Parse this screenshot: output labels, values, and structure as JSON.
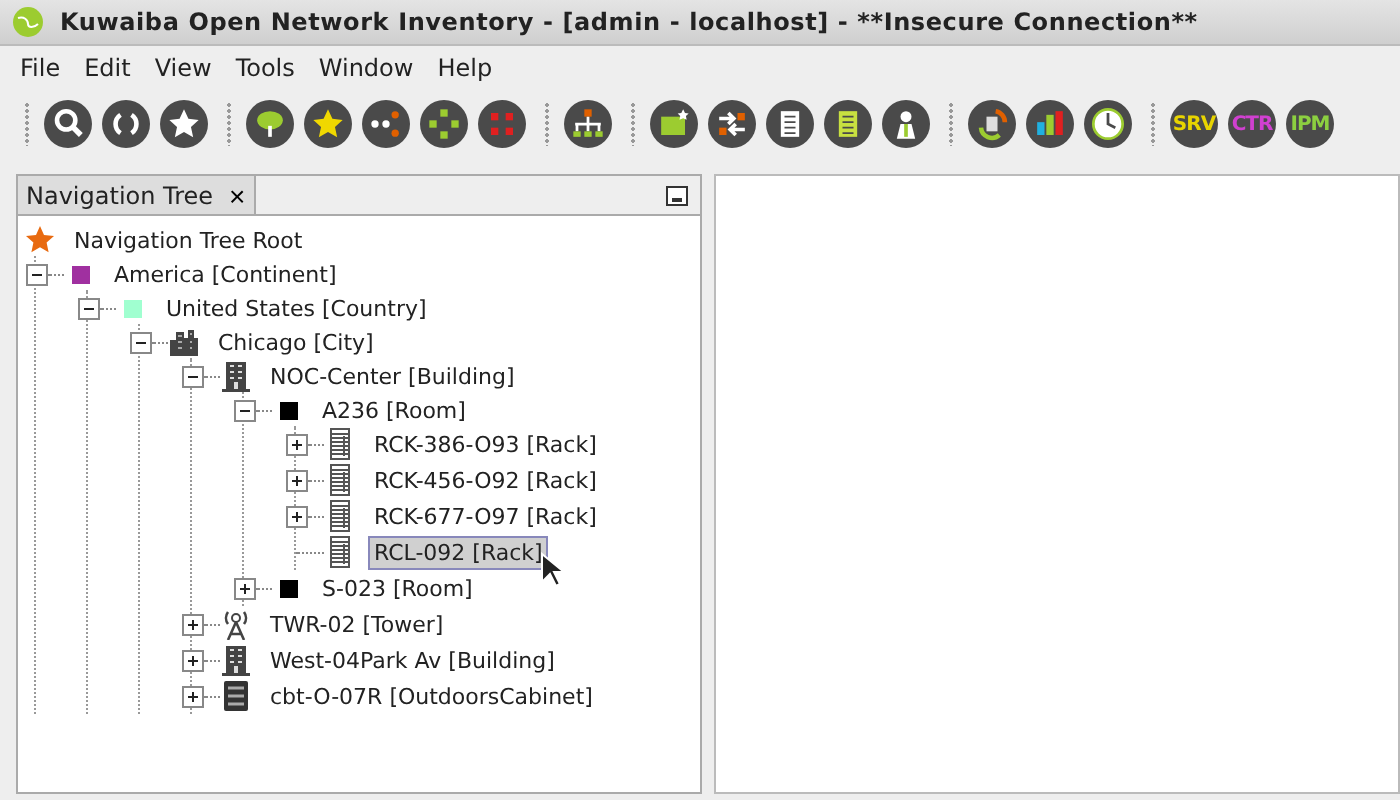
{
  "window": {
    "title": "Kuwaiba Open Network Inventory - [admin - localhost] - **Insecure Connection**"
  },
  "menu": [
    "File",
    "Edit",
    "View",
    "Tools",
    "Window",
    "Help"
  ],
  "toolbar": [
    [
      {
        "kind": "search"
      },
      {
        "kind": "refresh"
      },
      {
        "kind": "star"
      }
    ],
    [
      {
        "kind": "tree"
      },
      {
        "kind": "star-yellow"
      },
      {
        "kind": "nodes"
      },
      {
        "kind": "diamond"
      },
      {
        "kind": "grid"
      }
    ],
    [
      {
        "kind": "hierarchy"
      }
    ],
    [
      {
        "kind": "folder"
      },
      {
        "kind": "swap"
      },
      {
        "kind": "document"
      },
      {
        "kind": "document-green"
      },
      {
        "kind": "person"
      }
    ],
    [
      {
        "kind": "sync"
      },
      {
        "kind": "chart"
      },
      {
        "kind": "clock"
      }
    ],
    [
      {
        "kind": "text",
        "label": "SRV",
        "color": "#e8d400"
      },
      {
        "kind": "text",
        "label": "CTR",
        "color": "#d040d0"
      },
      {
        "kind": "text",
        "label": "IPM",
        "color": "#8cd040"
      }
    ]
  ],
  "panel": {
    "tab": "Navigation Tree",
    "close": "×"
  },
  "tree": {
    "label": "Navigation Tree Root",
    "kind": "star",
    "selected": false,
    "children": [
      {
        "label": "America [Continent]",
        "kind": "square",
        "color": "#a030a0",
        "expanded": true,
        "selected": false,
        "children": [
          {
            "label": "United States [Country]",
            "kind": "square",
            "color": "#a0ffd0",
            "expanded": true,
            "selected": false,
            "children": [
              {
                "label": "Chicago [City]",
                "kind": "city",
                "expanded": true,
                "selected": false,
                "children": [
                  {
                    "label": "NOC-Center [Building]",
                    "kind": "building",
                    "expanded": true,
                    "selected": false,
                    "children": [
                      {
                        "label": "A236 [Room]",
                        "kind": "square",
                        "color": "#000000",
                        "expanded": true,
                        "selected": false,
                        "children": [
                          {
                            "label": "RCK-386-O93 [Rack]",
                            "kind": "rack",
                            "expanded": false,
                            "selected": false
                          },
                          {
                            "label": "RCK-456-O92 [Rack]",
                            "kind": "rack",
                            "expanded": false,
                            "selected": false
                          },
                          {
                            "label": "RCK-677-O97 [Rack]",
                            "kind": "rack",
                            "expanded": false,
                            "selected": false
                          },
                          {
                            "label": "RCL-092 [Rack]",
                            "kind": "rack",
                            "selected": true
                          }
                        ]
                      },
                      {
                        "label": "S-023 [Room]",
                        "kind": "square",
                        "color": "#000000",
                        "expanded": false,
                        "selected": false
                      }
                    ]
                  },
                  {
                    "label": "TWR-02 [Tower]",
                    "kind": "tower",
                    "expanded": false,
                    "selected": false
                  },
                  {
                    "label": "West-04Park Av [Building]",
                    "kind": "building",
                    "expanded": false,
                    "selected": false
                  },
                  {
                    "label": "cbt-O-07R [OutdoorsCabinet]",
                    "kind": "cabinet",
                    "expanded": false,
                    "selected": false
                  }
                ]
              }
            ]
          }
        ]
      }
    ]
  }
}
